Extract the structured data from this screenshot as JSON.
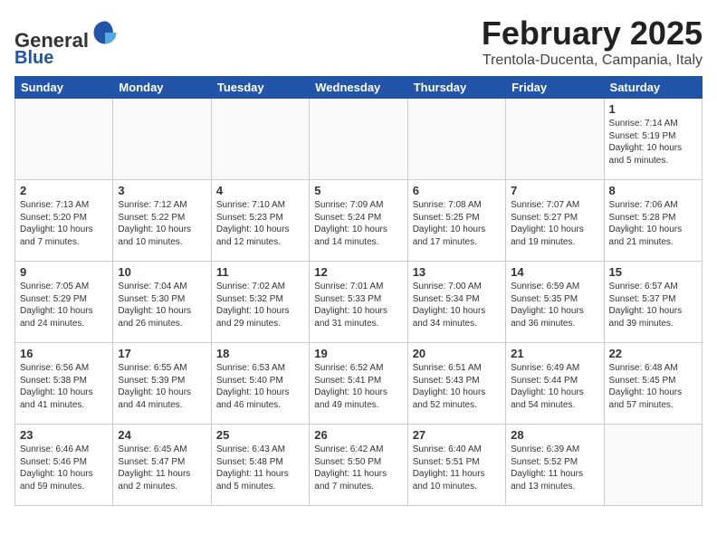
{
  "header": {
    "logo_general": "General",
    "logo_blue": "Blue",
    "month_title": "February 2025",
    "location": "Trentola-Ducenta, Campania, Italy"
  },
  "days_of_week": [
    "Sunday",
    "Monday",
    "Tuesday",
    "Wednesday",
    "Thursday",
    "Friday",
    "Saturday"
  ],
  "weeks": [
    [
      {
        "day": "",
        "text": ""
      },
      {
        "day": "",
        "text": ""
      },
      {
        "day": "",
        "text": ""
      },
      {
        "day": "",
        "text": ""
      },
      {
        "day": "",
        "text": ""
      },
      {
        "day": "",
        "text": ""
      },
      {
        "day": "1",
        "text": "Sunrise: 7:14 AM\nSunset: 5:19 PM\nDaylight: 10 hours\nand 5 minutes."
      }
    ],
    [
      {
        "day": "2",
        "text": "Sunrise: 7:13 AM\nSunset: 5:20 PM\nDaylight: 10 hours\nand 7 minutes."
      },
      {
        "day": "3",
        "text": "Sunrise: 7:12 AM\nSunset: 5:22 PM\nDaylight: 10 hours\nand 10 minutes."
      },
      {
        "day": "4",
        "text": "Sunrise: 7:10 AM\nSunset: 5:23 PM\nDaylight: 10 hours\nand 12 minutes."
      },
      {
        "day": "5",
        "text": "Sunrise: 7:09 AM\nSunset: 5:24 PM\nDaylight: 10 hours\nand 14 minutes."
      },
      {
        "day": "6",
        "text": "Sunrise: 7:08 AM\nSunset: 5:25 PM\nDaylight: 10 hours\nand 17 minutes."
      },
      {
        "day": "7",
        "text": "Sunrise: 7:07 AM\nSunset: 5:27 PM\nDaylight: 10 hours\nand 19 minutes."
      },
      {
        "day": "8",
        "text": "Sunrise: 7:06 AM\nSunset: 5:28 PM\nDaylight: 10 hours\nand 21 minutes."
      }
    ],
    [
      {
        "day": "9",
        "text": "Sunrise: 7:05 AM\nSunset: 5:29 PM\nDaylight: 10 hours\nand 24 minutes."
      },
      {
        "day": "10",
        "text": "Sunrise: 7:04 AM\nSunset: 5:30 PM\nDaylight: 10 hours\nand 26 minutes."
      },
      {
        "day": "11",
        "text": "Sunrise: 7:02 AM\nSunset: 5:32 PM\nDaylight: 10 hours\nand 29 minutes."
      },
      {
        "day": "12",
        "text": "Sunrise: 7:01 AM\nSunset: 5:33 PM\nDaylight: 10 hours\nand 31 minutes."
      },
      {
        "day": "13",
        "text": "Sunrise: 7:00 AM\nSunset: 5:34 PM\nDaylight: 10 hours\nand 34 minutes."
      },
      {
        "day": "14",
        "text": "Sunrise: 6:59 AM\nSunset: 5:35 PM\nDaylight: 10 hours\nand 36 minutes."
      },
      {
        "day": "15",
        "text": "Sunrise: 6:57 AM\nSunset: 5:37 PM\nDaylight: 10 hours\nand 39 minutes."
      }
    ],
    [
      {
        "day": "16",
        "text": "Sunrise: 6:56 AM\nSunset: 5:38 PM\nDaylight: 10 hours\nand 41 minutes."
      },
      {
        "day": "17",
        "text": "Sunrise: 6:55 AM\nSunset: 5:39 PM\nDaylight: 10 hours\nand 44 minutes."
      },
      {
        "day": "18",
        "text": "Sunrise: 6:53 AM\nSunset: 5:40 PM\nDaylight: 10 hours\nand 46 minutes."
      },
      {
        "day": "19",
        "text": "Sunrise: 6:52 AM\nSunset: 5:41 PM\nDaylight: 10 hours\nand 49 minutes."
      },
      {
        "day": "20",
        "text": "Sunrise: 6:51 AM\nSunset: 5:43 PM\nDaylight: 10 hours\nand 52 minutes."
      },
      {
        "day": "21",
        "text": "Sunrise: 6:49 AM\nSunset: 5:44 PM\nDaylight: 10 hours\nand 54 minutes."
      },
      {
        "day": "22",
        "text": "Sunrise: 6:48 AM\nSunset: 5:45 PM\nDaylight: 10 hours\nand 57 minutes."
      }
    ],
    [
      {
        "day": "23",
        "text": "Sunrise: 6:46 AM\nSunset: 5:46 PM\nDaylight: 10 hours\nand 59 minutes."
      },
      {
        "day": "24",
        "text": "Sunrise: 6:45 AM\nSunset: 5:47 PM\nDaylight: 11 hours\nand 2 minutes."
      },
      {
        "day": "25",
        "text": "Sunrise: 6:43 AM\nSunset: 5:48 PM\nDaylight: 11 hours\nand 5 minutes."
      },
      {
        "day": "26",
        "text": "Sunrise: 6:42 AM\nSunset: 5:50 PM\nDaylight: 11 hours\nand 7 minutes."
      },
      {
        "day": "27",
        "text": "Sunrise: 6:40 AM\nSunset: 5:51 PM\nDaylight: 11 hours\nand 10 minutes."
      },
      {
        "day": "28",
        "text": "Sunrise: 6:39 AM\nSunset: 5:52 PM\nDaylight: 11 hours\nand 13 minutes."
      },
      {
        "day": "",
        "text": ""
      }
    ]
  ]
}
